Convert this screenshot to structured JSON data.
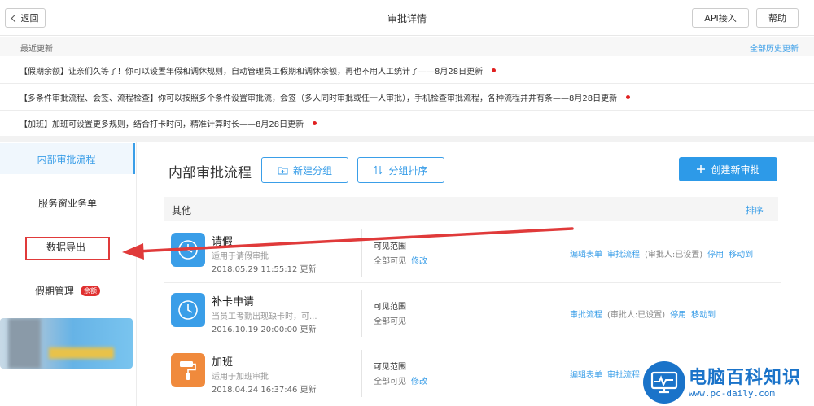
{
  "header": {
    "back_label": "返回",
    "title": "审批详情",
    "api_label": "API接入",
    "help_label": "帮助"
  },
  "updates": {
    "label": "最近更新",
    "all_history": "全部历史更新",
    "items": [
      "【假期余额】让亲们久等了！你可以设置年假和调休规则，自动管理员工假期和调休余额，再也不用人工统计了——8月28日更新",
      "【多条件审批流程、会签、流程检查】你可以按照多个条件设置审批流，会签（多人同时审批或任一人审批），手机检查审批流程，各种流程井井有条——8月28日更新",
      "【加班】加班可设置更多规则，结合打卡时间，精准计算时长——8月28日更新"
    ]
  },
  "sidebar": {
    "items": [
      {
        "label": "内部审批流程"
      },
      {
        "label": "服务窗业务单"
      },
      {
        "label": "数据导出"
      },
      {
        "label": "假期管理",
        "badge": "余额"
      }
    ]
  },
  "main": {
    "title": "内部审批流程",
    "new_group": "新建分组",
    "group_sort": "分组排序",
    "create": "创建新审批",
    "group": {
      "name": "其他",
      "sort": "排序"
    },
    "cards": [
      {
        "name": "请假",
        "desc": "适用于请假审批",
        "time": "2018.05.29 11:55:12 更新",
        "icon": "clock-icon",
        "color": "#3a9ee8",
        "scope_label": "可见范围",
        "scope_value": "全部可见",
        "scope_edit": "修改",
        "actions": [
          "编辑表单",
          "审批流程",
          "(审批人:已设置)",
          "停用",
          "移动到"
        ]
      },
      {
        "name": "补卡申请",
        "desc": "当员工考勤出现缺卡时，可...",
        "time": "2016.10.19 20:00:00 更新",
        "icon": "clock-icon",
        "color": "#3a9ee8",
        "scope_label": "可见范围",
        "scope_value": "全部可见",
        "scope_edit": "",
        "actions": [
          "审批流程",
          "(审批人:已设置)",
          "停用",
          "移动到"
        ]
      },
      {
        "name": "加班",
        "desc": "适用于加班审批",
        "time": "2018.04.24 16:37:46 更新",
        "icon": "paint-roller-icon",
        "color": "#f08a3c",
        "scope_label": "可见范围",
        "scope_value": "全部可见",
        "scope_edit": "修改",
        "actions": [
          "编辑表单",
          "审批流程"
        ]
      }
    ]
  },
  "watermark": {
    "title": "电脑百科知识",
    "url": "www.pc-daily.com"
  },
  "colors": {
    "accent": "#3a9ee8",
    "primary_button": "#2d9ae8",
    "annotation_red": "#e03a3a"
  }
}
